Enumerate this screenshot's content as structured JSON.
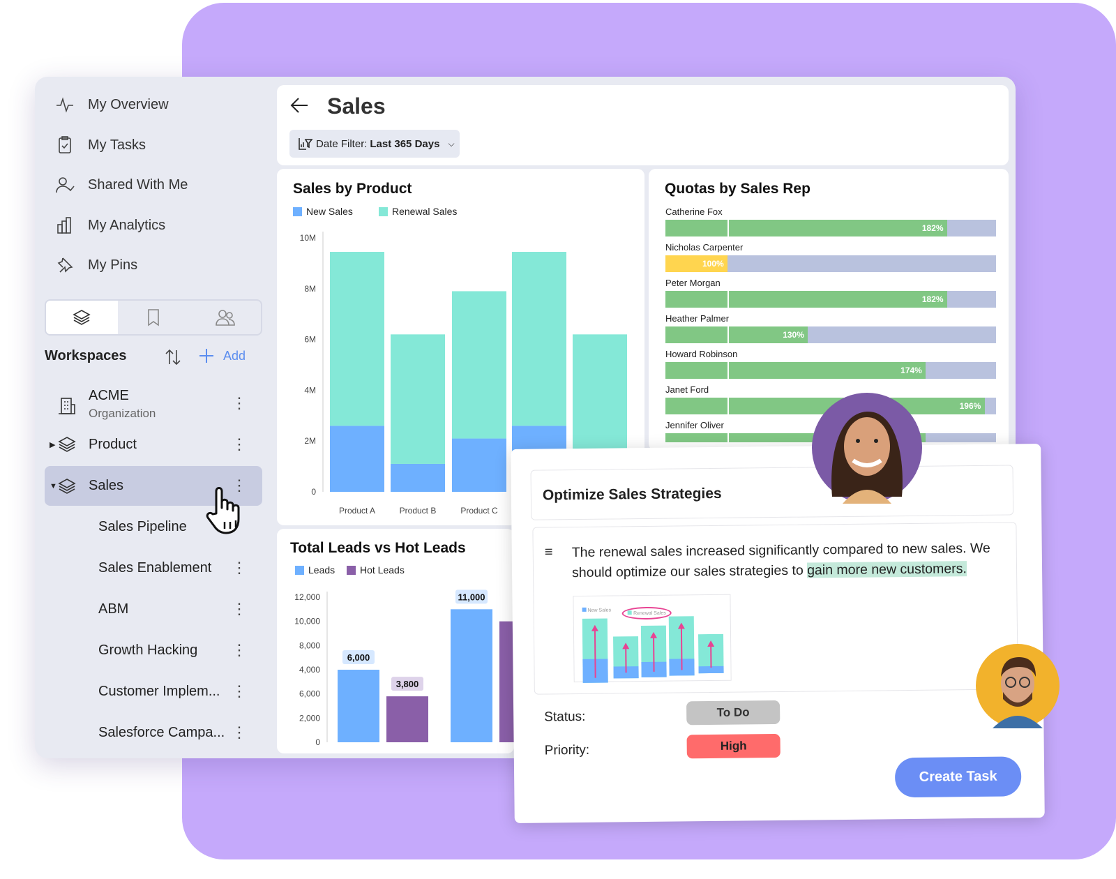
{
  "colors": {
    "background": "#c5a9fb",
    "accent": "#5b8def",
    "new_sales": "#6eb0ff",
    "renewal_sales": "#84e8d7",
    "leads": "#6eb0ff",
    "hot_leads": "#8a5fa8",
    "quota_over": "#81c784",
    "quota_met": "#ffd54f",
    "quota_remaining": "#b9c2de",
    "priority_high": "#ff6b6b",
    "status_todo": "#c4c4c4"
  },
  "sidebar": {
    "nav": [
      {
        "label": "My Overview",
        "icon": "activity-icon"
      },
      {
        "label": "My Tasks",
        "icon": "clipboard-check-icon"
      },
      {
        "label": "Shared With Me",
        "icon": "user-check-icon"
      },
      {
        "label": "My Analytics",
        "icon": "bar-chart-icon"
      },
      {
        "label": "My Pins",
        "icon": "pin-icon"
      }
    ],
    "tabs": [
      "layers-icon",
      "bookmark-icon",
      "users-icon"
    ],
    "workspaces_title": "Workspaces",
    "add_label": "Add",
    "workspaces": [
      {
        "label": "ACME",
        "sublabel": "Organization",
        "icon": "building-icon"
      },
      {
        "label": "Product",
        "icon": "layers-icon"
      },
      {
        "label": "Sales",
        "icon": "layers-icon",
        "selected": true
      }
    ],
    "sales_children": [
      "Sales Pipeline",
      "Sales Enablement",
      "ABM",
      "Growth Hacking",
      "Customer Implem...",
      "Salesforce Campa..."
    ]
  },
  "header": {
    "title": "Sales",
    "date_filter_label": "Date Filter:",
    "date_filter_value": "Last 365 Days"
  },
  "chart_data": [
    {
      "type": "bar",
      "stacked": true,
      "title": "Sales by Product",
      "categories": [
        "Product A",
        "Product B",
        "Product C",
        "",
        ""
      ],
      "series": [
        {
          "name": "New Sales",
          "values": [
            2.6,
            1.1,
            2.1,
            2.6,
            1.0
          ]
        },
        {
          "name": "Renewal Sales",
          "values": [
            6.85,
            5.1,
            5.8,
            6.85,
            5.2
          ]
        }
      ],
      "yticks": [
        "0",
        "2M",
        "4M",
        "6M",
        "8M",
        "10M"
      ],
      "ylim": [
        0,
        10
      ],
      "legend": "top-left"
    },
    {
      "type": "bar",
      "title": "Total Leads vs Hot Leads",
      "series": [
        {
          "name": "Leads",
          "values": [
            6000,
            11000
          ]
        },
        {
          "name": "Hot Leads",
          "values": [
            3800,
            10000
          ]
        }
      ],
      "data_labels": [
        [
          "6,000",
          "11,000"
        ],
        [
          "3,800",
          ""
        ]
      ],
      "yticks": [
        "0",
        "2,000",
        "6,000",
        "4,000",
        "8,000",
        "10,000",
        "12,000"
      ],
      "ylim": [
        0,
        12000
      ],
      "legend": "top-left"
    },
    {
      "type": "bar",
      "orientation": "horizontal",
      "title": "Quotas by Sales Rep",
      "categories": [
        "Catherine Fox",
        "Nicholas Carpenter",
        "Peter Morgan",
        "Heather Palmer",
        "Howard Robinson",
        "Janet Ford",
        "Jennifer Oliver"
      ],
      "values": [
        182,
        100,
        182,
        130,
        174,
        196,
        174
      ],
      "labels": [
        "182%",
        "100%",
        "182%",
        "130%",
        "174%",
        "196%",
        "174%"
      ]
    }
  ],
  "task": {
    "title": "Optimize Sales Strategies",
    "note_prefix": "The renewal sales increased significantly compared to new sales. We should optimize our sales strategies to ",
    "note_highlight": "gain more new customers.",
    "thumb_legend": [
      "New Sales",
      "Renewal Sales"
    ],
    "status_label": "Status:",
    "status_value": "To Do",
    "priority_label": "Priority:",
    "priority_value": "High",
    "create_button": "Create Task"
  }
}
